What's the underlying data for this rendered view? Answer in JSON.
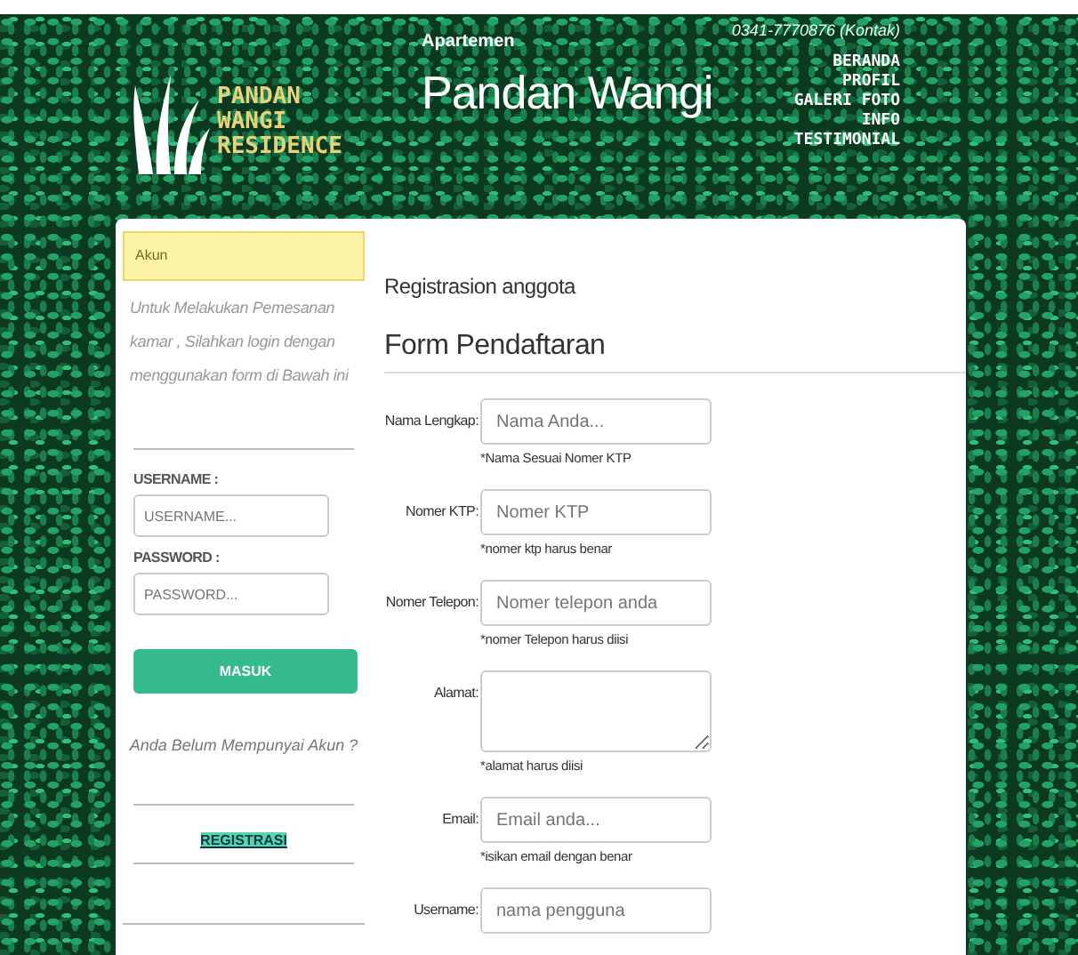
{
  "header": {
    "logo_lines": [
      "PANDAN",
      "WANGI",
      "RESIDENCE"
    ],
    "subtitle": "Apartemen",
    "title": "Pandan Wangi",
    "contact": "0341-7770876 (Kontak)",
    "nav": [
      {
        "label": "BERANDA"
      },
      {
        "label": "PROFIL"
      },
      {
        "label": "GALERI FOTO"
      },
      {
        "label": "INFO"
      },
      {
        "label": "TESTIMONIAL"
      }
    ]
  },
  "login": {
    "heading": "Akun",
    "intro": "Untuk Melakukan Pemesanan kamar , Silahkan login dengan menggunakan form di Bawah ini",
    "fields": [
      {
        "label": "USERNAME :",
        "placeholder": "USERNAME..."
      },
      {
        "label": "PASSWORD :",
        "placeholder": "PASSWORD..."
      }
    ],
    "submit": "MASUK",
    "prompt": "Anda Belum Mempunyai Akun ?",
    "register_link": "REGISTRASI"
  },
  "form": {
    "caption": "Registrasion anggota",
    "title": "Form Pendaftaran",
    "fields": [
      {
        "kind": "input",
        "label": "Nama Lengkap:",
        "placeholder": "Nama Anda...",
        "hint": "*Nama Sesuai Nomer KTP"
      },
      {
        "kind": "input",
        "label": "Nomer KTP:",
        "placeholder": "Nomer KTP",
        "hint": "*nomer ktp harus benar"
      },
      {
        "kind": "input",
        "label": "Nomer Telepon:",
        "placeholder": "Nomer telepon anda",
        "hint": "*nomer Telepon harus diisi"
      },
      {
        "kind": "textarea",
        "label": "Alamat:",
        "hint": "*alamat harus diisi"
      },
      {
        "kind": "input",
        "label": "Email:",
        "placeholder": "Email anda...",
        "hint": "*isikan email dengan benar"
      },
      {
        "kind": "input",
        "label": "Username:",
        "placeholder": "nama pengguna"
      }
    ]
  }
}
